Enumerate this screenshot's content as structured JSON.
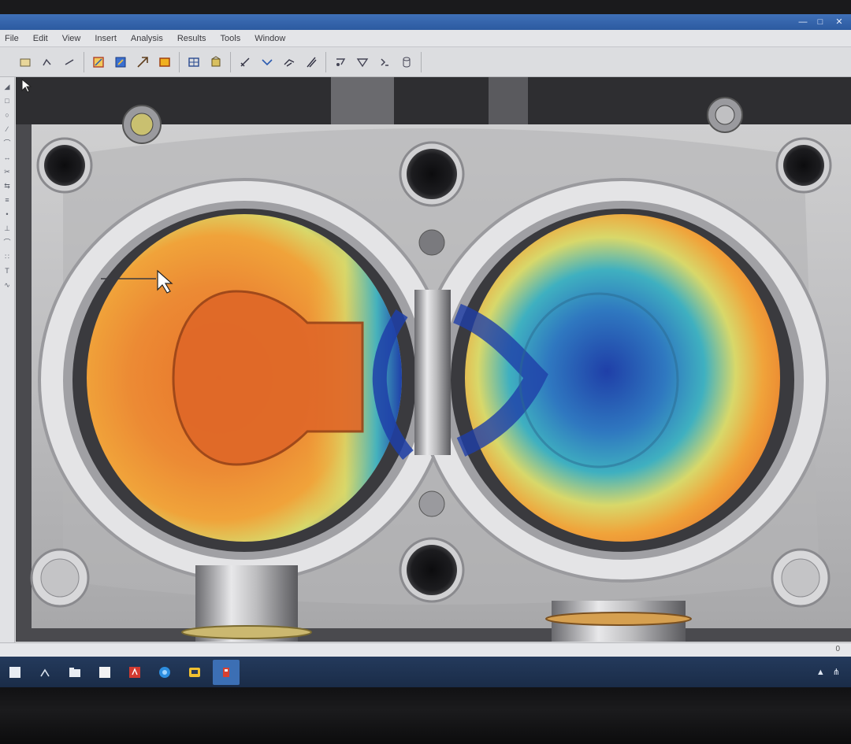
{
  "window": {
    "title": ""
  },
  "menu": {
    "items": [
      {
        "label": "File"
      },
      {
        "label": "Edit"
      },
      {
        "label": "View"
      },
      {
        "label": "Insert"
      },
      {
        "label": "Analysis"
      },
      {
        "label": "Results"
      },
      {
        "label": "Tools"
      },
      {
        "label": "Window"
      }
    ]
  },
  "toolbar": {
    "icons": [
      "select-icon",
      "sketch-icon",
      "line-icon",
      "rotate-view-icon",
      "zoom-icon",
      "pan-icon",
      "color-map-icon",
      "mesh-icon",
      "section-icon",
      "measure-icon",
      "probe-icon",
      "vector-icon",
      "slice-icon",
      "filter-icon",
      "export-icon",
      "settings-icon"
    ]
  },
  "status": {
    "left": "",
    "right": "0"
  },
  "taskbar": {
    "apps": [
      "start-icon",
      "network-icon",
      "folder-icon",
      "document-icon",
      "pdf-icon",
      "browser-icon",
      "mail-icon",
      "simulation-app-icon"
    ]
  },
  "tray": {
    "time": "",
    "date": ""
  },
  "colors": {
    "hot": "#e8742a",
    "warm": "#f0a33a",
    "mid": "#d8d86a",
    "cool": "#3fb0c0",
    "cold": "#1f3fa8"
  }
}
